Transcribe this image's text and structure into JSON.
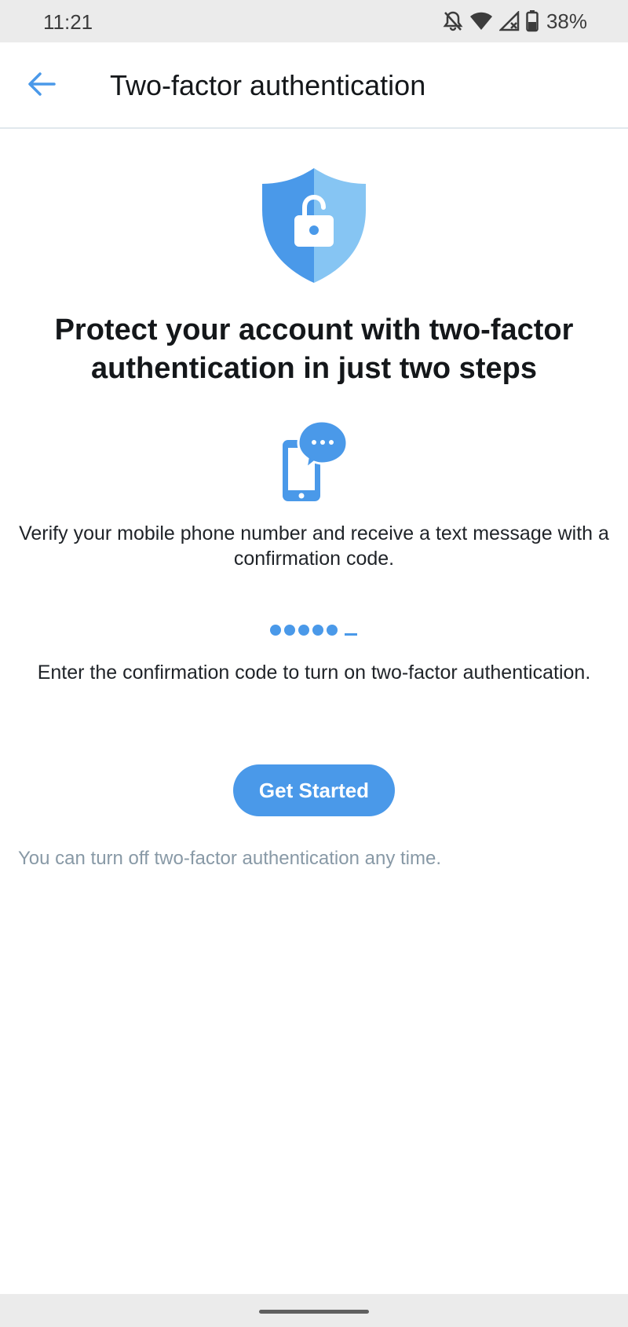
{
  "status_bar": {
    "time": "11:21",
    "battery": "38%",
    "icons": [
      "notifications-off-icon",
      "wifi-icon",
      "cellular-no-data-icon",
      "battery-icon"
    ]
  },
  "app_bar": {
    "title": "Two-factor authentication",
    "back_icon": "arrow-left-icon"
  },
  "hero": {
    "icon": "shield-unlocked-icon",
    "headline": "Protect your account with two-factor authentication in just two steps"
  },
  "steps": [
    {
      "icon": "phone-message-icon",
      "text": "Verify your mobile phone number and receive a text message with a confirmation code."
    },
    {
      "icon": "confirmation-code-icon",
      "text": "Enter the confirmation code to turn on two-factor authentication."
    }
  ],
  "cta": {
    "label": "Get Started"
  },
  "footnote": "You can turn off two-factor authentication any time.",
  "colors": {
    "accent": "#4a99e9",
    "accent_light": "#86c5f3",
    "text_primary": "#14171a",
    "text_secondary": "#8899a6",
    "divider": "#e1e8ed"
  }
}
